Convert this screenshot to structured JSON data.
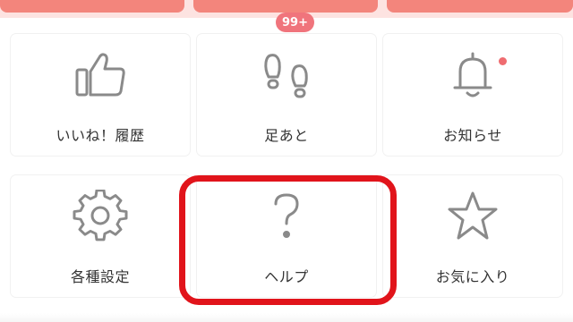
{
  "colors": {
    "accent": "#f3857c",
    "badge": "#f0747c",
    "highlight": "#e1141b",
    "icon_stroke": "#8a8a8a"
  },
  "menu": {
    "items": [
      {
        "label": "いいね！履歴",
        "icon": "thumbs-up-icon"
      },
      {
        "label": "足あと",
        "icon": "footprints-icon",
        "badge": "99+"
      },
      {
        "label": "お知らせ",
        "icon": "bell-icon",
        "notification_dot": true
      },
      {
        "label": "各種設定",
        "icon": "gear-icon"
      },
      {
        "label": "ヘルプ",
        "icon": "question-mark-icon",
        "highlighted": true
      },
      {
        "label": "お気に入り",
        "icon": "star-icon"
      }
    ]
  }
}
